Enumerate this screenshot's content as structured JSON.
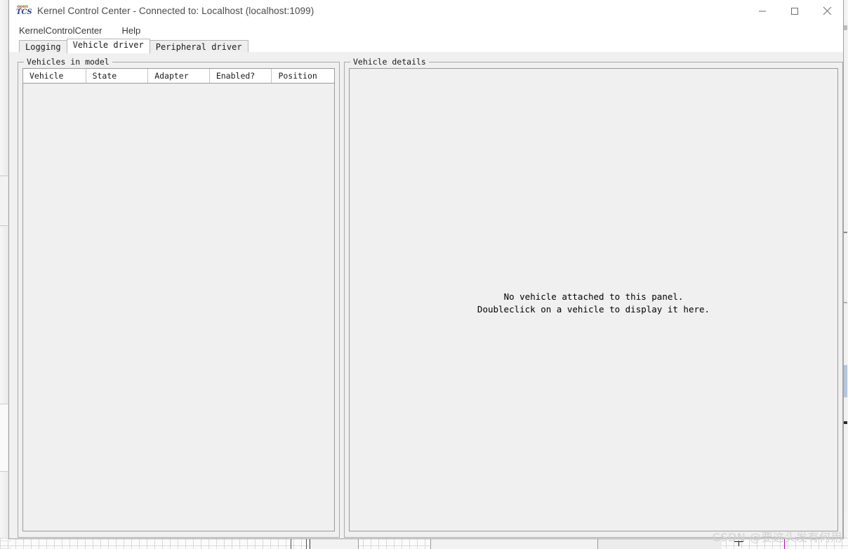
{
  "window": {
    "title": "Kernel Control Center - Connected to: Localhost (localhost:1099)",
    "logo": {
      "top_text": "open",
      "bottom_text": "TCS",
      "top_color": "#b06a28",
      "bottom_color": "#2b3f8c"
    },
    "controls": {
      "minimize": "minimize-icon",
      "maximize": "maximize-icon",
      "close": "close-icon"
    }
  },
  "menubar": {
    "items": [
      {
        "label": "KernelControlCenter"
      },
      {
        "label": "Help"
      }
    ]
  },
  "tabs": [
    {
      "label": "Logging",
      "selected": false
    },
    {
      "label": "Vehicle driver",
      "selected": true
    },
    {
      "label": "Peripheral driver",
      "selected": false
    }
  ],
  "vehicles_panel": {
    "title": "Vehicles in model",
    "table": {
      "columns": [
        "Vehicle",
        "State",
        "Adapter",
        "Enabled?",
        "Position"
      ],
      "rows": []
    }
  },
  "details_panel": {
    "title": "Vehicle details",
    "placeholder_line1": "No vehicle attached to this panel.",
    "placeholder_line2": "Doubleclick on a vehicle to display it here.",
    "placeholder": "No vehicle attached to this panel.\nDoubleclick on a vehicle to display it here."
  },
  "watermark": {
    "text": "CSDN @要这头发有何用"
  },
  "colors": {
    "panel_background": "#f0f0f0",
    "titlebar_background": "#ffffff",
    "border": "#a9a9a9",
    "text": "#1a1a1a",
    "title_text": "#4a4a4a"
  }
}
